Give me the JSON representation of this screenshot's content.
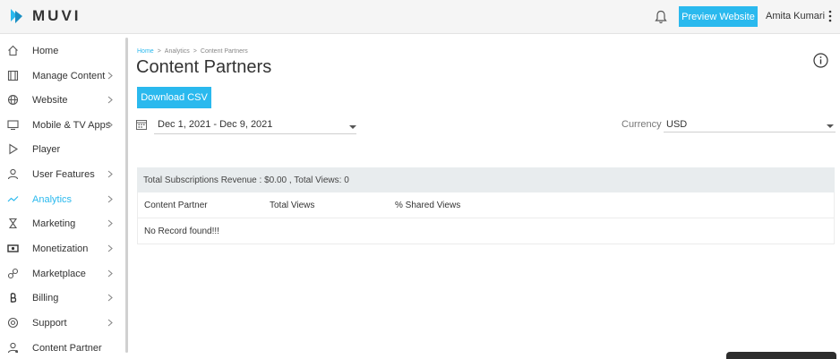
{
  "header": {
    "logo_text": "MUVI",
    "preview_label": "Preview Website",
    "user_name": "Amita Kumari"
  },
  "sidebar": {
    "items": [
      {
        "label": "Home",
        "icon": "home-icon",
        "chevron": false
      },
      {
        "label": "Manage Content",
        "icon": "film-icon",
        "chevron": true
      },
      {
        "label": "Website",
        "icon": "globe-icon",
        "chevron": true
      },
      {
        "label": "Mobile & TV Apps",
        "icon": "monitor-icon",
        "chevron": true
      },
      {
        "label": "Player",
        "icon": "play-icon",
        "chevron": false
      },
      {
        "label": "User Features",
        "icon": "user-icon",
        "chevron": true
      },
      {
        "label": "Analytics",
        "icon": "analytics-icon",
        "chevron": true,
        "active": true
      },
      {
        "label": "Marketing",
        "icon": "hourglass-icon",
        "chevron": true
      },
      {
        "label": "Monetization",
        "icon": "money-icon",
        "chevron": true
      },
      {
        "label": "Marketplace",
        "icon": "link-icon",
        "chevron": true
      },
      {
        "label": "Billing",
        "icon": "bitcoin-icon",
        "chevron": true
      },
      {
        "label": "Support",
        "icon": "support-icon",
        "chevron": true
      },
      {
        "label": "Content Partner",
        "icon": "partner-icon",
        "chevron": false
      }
    ]
  },
  "breadcrumb": {
    "items": [
      "Home",
      "Analytics",
      "Content Partners"
    ],
    "separator": ">"
  },
  "page": {
    "title": "Content Partners",
    "download_label": "Download CSV"
  },
  "filters": {
    "date_range": "Dec 1, 2021 - Dec 9, 2021",
    "currency_label": "Currency",
    "currency_value": "USD"
  },
  "summary": "Total Subscriptions Revenue : $0.00 , Total Views: 0",
  "table": {
    "columns": [
      "Content Partner",
      "Total Views",
      "% Shared Views"
    ],
    "empty_message": "No Record found!!!"
  },
  "colors": {
    "accent": "#2ab9ee",
    "header_bg": "#f5f5f5",
    "summary_bg": "#e8ecee"
  }
}
